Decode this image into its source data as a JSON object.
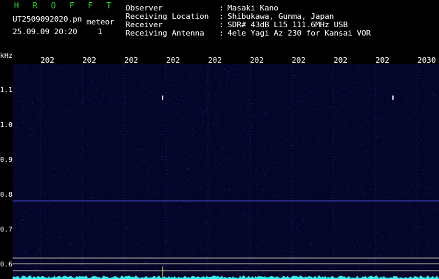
{
  "header": {
    "brand": "H R O F F T",
    "filename": "UT2509092020.pn",
    "label": "meteor",
    "datetime": "25.09.09 20:20",
    "counter": "1"
  },
  "info": [
    {
      "key": "Observer",
      "value": "Masaki Kano"
    },
    {
      "key": "Receiving Location",
      "value": "Shibukawa, Gunma, Japan"
    },
    {
      "key": "Receiver",
      "value": "SDR# 43dB L15 111.6MHz USB"
    },
    {
      "key": "Receiving Antenna",
      "value": "4ele Yagi Az 230 for Kansai VOR"
    }
  ],
  "separator": ":",
  "spectrogram": {
    "y_unit": "kHz",
    "y_ticks": [
      "1.1",
      "1.0",
      "0.9",
      "0.8",
      "0.7",
      "0.6"
    ],
    "x_ticks": [
      "202",
      "202",
      "202",
      "202",
      "202",
      "202",
      "202",
      "202",
      "202",
      "2030"
    ],
    "colors": {
      "background": "#05052a",
      "noise": "#2a2aa8",
      "grid": "#5a5aff",
      "line": "#c9c9a8",
      "trace": "#2ef2f2"
    }
  }
}
